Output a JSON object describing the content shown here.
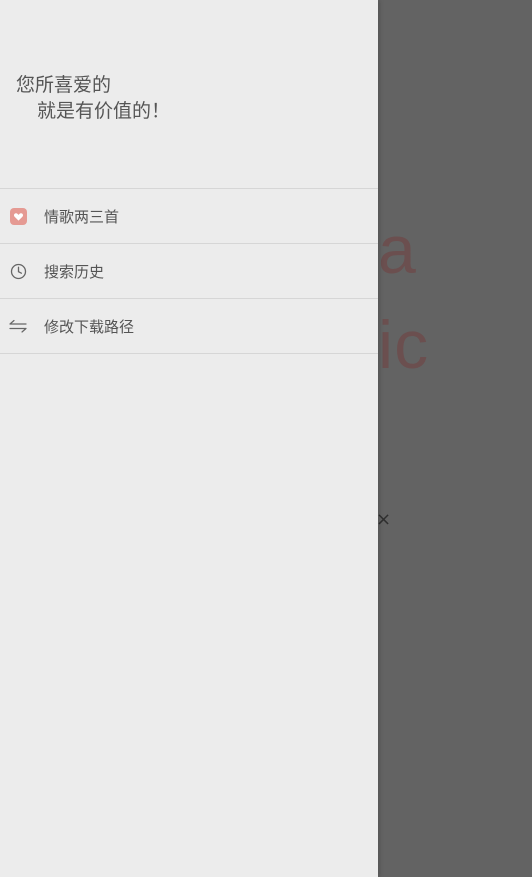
{
  "background": {
    "partial_text_line1": "a",
    "partial_text_line2": "ic",
    "close_glyph": "×"
  },
  "drawer": {
    "slogan_line1": "您所喜爱的",
    "slogan_line2": "就是有价值的！",
    "menu_items": [
      {
        "label": "情歌两三首",
        "icon": "heart-icon"
      },
      {
        "label": "搜索历史",
        "icon": "clock-icon"
      },
      {
        "label": "修改下载路径",
        "icon": "swap-arrows-icon"
      }
    ]
  },
  "colors": {
    "drawer_bg": "#ececec",
    "overlay_bg": "#636363",
    "accent_heart": "#e59a93",
    "text": "#555555"
  }
}
